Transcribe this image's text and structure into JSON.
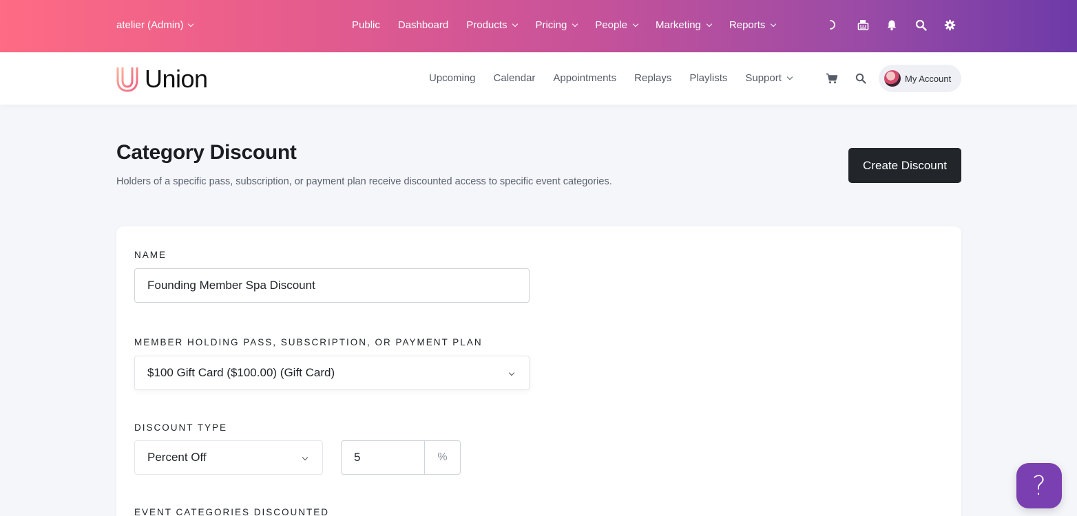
{
  "admin_bar": {
    "org_label": "atelier (Admin)",
    "nav": [
      {
        "label": "Public",
        "dropdown": false
      },
      {
        "label": "Dashboard",
        "dropdown": false
      },
      {
        "label": "Products",
        "dropdown": true
      },
      {
        "label": "Pricing",
        "dropdown": true
      },
      {
        "label": "People",
        "dropdown": true
      },
      {
        "label": "Marketing",
        "dropdown": true
      },
      {
        "label": "Reports",
        "dropdown": true
      }
    ],
    "icons": [
      "loading-icon",
      "register-icon",
      "bell-icon",
      "search-icon",
      "gear-icon"
    ],
    "gradient": [
      "#fe6b84",
      "#6d3aa8"
    ]
  },
  "site_header": {
    "brand": "Union",
    "nav": [
      {
        "label": "Upcoming"
      },
      {
        "label": "Calendar"
      },
      {
        "label": "Appointments"
      },
      {
        "label": "Replays"
      },
      {
        "label": "Playlists"
      },
      {
        "label": "Support",
        "dropdown": true
      }
    ],
    "account_label": "My Account"
  },
  "page": {
    "title": "Category Discount",
    "subtitle": "Holders of a specific pass, subscription, or payment plan receive discounted access to specific event categories.",
    "create_button": "Create Discount"
  },
  "form": {
    "name_label": "NAME",
    "name_value": "Founding Member Spa Discount",
    "member_label": "MEMBER HOLDING PASS, SUBSCRIPTION, OR PAYMENT PLAN",
    "member_value": "$100 Gift Card ($100.00) (Gift Card)",
    "discount_type_label": "DISCOUNT TYPE",
    "discount_type_value": "Percent Off",
    "discount_amount": "5",
    "discount_unit": "%",
    "categories_label": "EVENT CATEGORIES DISCOUNTED"
  },
  "help_button": "?",
  "colors": {
    "accent_dark": "#22262b",
    "help_purple": "#7a3fb0",
    "background": "#f5f6fa"
  }
}
